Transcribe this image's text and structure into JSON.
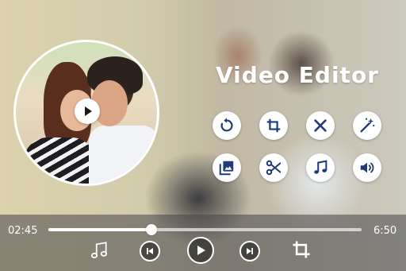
{
  "app": {
    "title": "Video Editor"
  },
  "colors": {
    "accent": "#1e3a78",
    "white": "#ffffff"
  },
  "thumbnail": {
    "play_icon": "play-icon"
  },
  "tools": [
    {
      "name": "rotate",
      "icon": "rotate-icon"
    },
    {
      "name": "crop",
      "icon": "crop-icon"
    },
    {
      "name": "delete",
      "icon": "close-icon"
    },
    {
      "name": "effects",
      "icon": "magic-wand-icon"
    },
    {
      "name": "gallery",
      "icon": "gallery-icon"
    },
    {
      "name": "cut",
      "icon": "scissors-icon"
    },
    {
      "name": "music",
      "icon": "music-note-icon"
    },
    {
      "name": "volume",
      "icon": "volume-icon"
    }
  ],
  "player": {
    "current_time": "02:45",
    "total_time": "6:50",
    "progress": 0.33
  },
  "controls": {
    "music": "music-note-icon",
    "previous": "skip-previous-icon",
    "play": "play-icon",
    "next": "skip-next-icon",
    "crop": "crop-icon"
  }
}
